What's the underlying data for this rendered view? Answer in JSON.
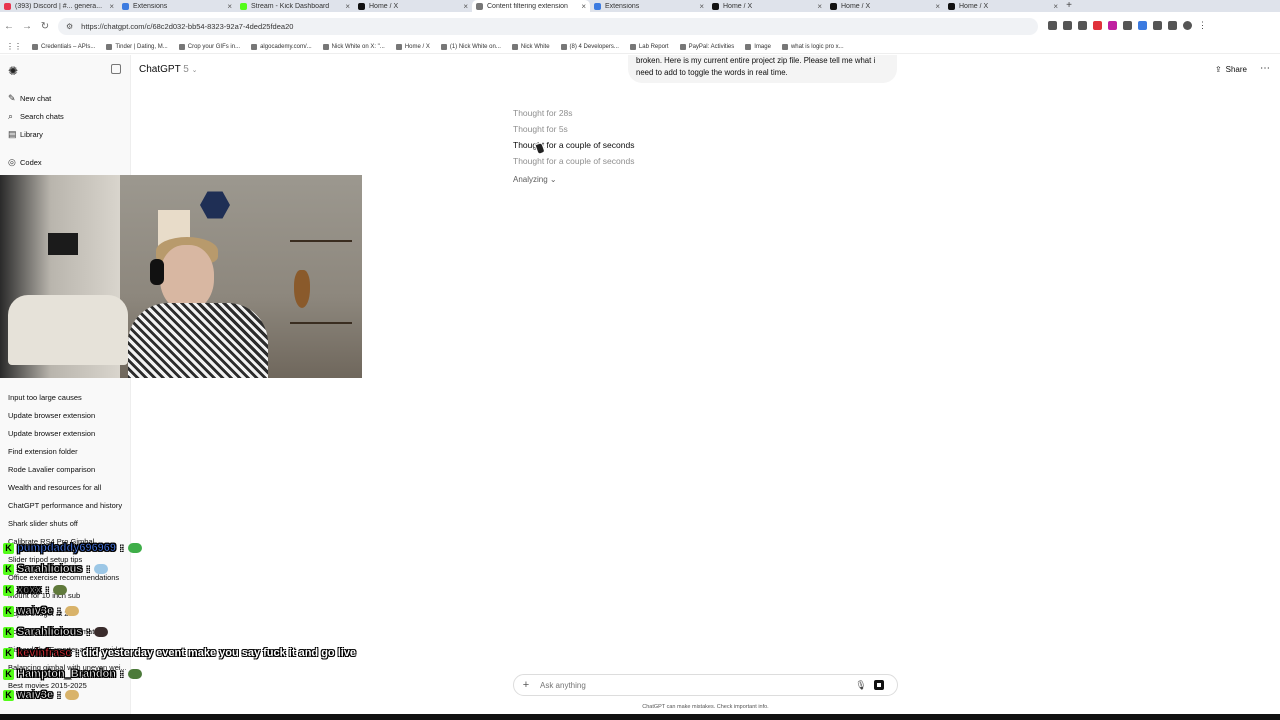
{
  "browser": {
    "tabs": [
      {
        "label": "(393) Discord | #... genera...",
        "color": "#e8344e"
      },
      {
        "label": "Extensions",
        "color": "#3c7be0"
      },
      {
        "label": "Stream - Kick Dashboard",
        "color": "#53fc18"
      },
      {
        "label": "Home / X",
        "color": "#111111"
      },
      {
        "label": "Content filtering extension",
        "color": "#777777"
      },
      {
        "label": "Extensions",
        "color": "#3c7be0"
      },
      {
        "label": "Home / X",
        "color": "#111111"
      },
      {
        "label": "Home / X",
        "color": "#111111"
      },
      {
        "label": "Home / X",
        "color": "#111111"
      }
    ],
    "new_tab": "+",
    "url": "https://chatgpt.com/c/68c2d032-bb54-8323-92a7-4ded25fdea20",
    "bookmarks": [
      "Credentials – APIs...",
      "Tinder | Dating, M...",
      "Crop your GIFs in...",
      "algocademy.com/...",
      "Nick White on X: \"...",
      "Home / X",
      "(1) Nick White on...",
      "Nick White",
      "(8) 4 Developers...",
      "Lab Report",
      "PayPal: Activities",
      "Image",
      "what is logic pro x..."
    ]
  },
  "sidebar": {
    "menu": [
      {
        "icon": "new-chat-icon",
        "glyph": "✎",
        "label": "New chat"
      },
      {
        "icon": "search-icon",
        "glyph": "⌕",
        "label": "Search chats"
      },
      {
        "icon": "library-icon",
        "glyph": "▤",
        "label": "Library"
      },
      {
        "icon": "codex-icon",
        "glyph": "◎",
        "label": "Codex"
      }
    ],
    "chats": [
      "Input too large causes",
      "Update browser extension",
      "Update browser extension",
      "Find extension folder",
      "Rode Lavalier comparison",
      "Wealth and resources for all",
      "ChatGPT performance and history",
      "Shark slider shuts off",
      "Calibrate RS4 Pro Gimbal",
      "Slider tripod setup tips",
      "Office exercise recommendations",
      "Mount for 10 inch sub",
      "Adjust budget at 28+",
      "Adsense earnings estimate",
      "DiscordChatExporter arm64 guide",
      "Balancing gimbal with uneven wei...",
      "Best movies 2015-2025"
    ]
  },
  "header": {
    "model": "ChatGPT",
    "version": "5",
    "share": "Share"
  },
  "conversation": {
    "user_message": "broken. Here is my current entire project zip file. Please tell me what i need to add to toggle the words in real time.",
    "thoughts": [
      "Thought for 28s",
      "Thought for 5s",
      "Thought for a couple of seconds",
      "Thought for a couple of seconds"
    ],
    "status": "Analyzing"
  },
  "composer": {
    "placeholder": "Ask anything",
    "disclaimer": "ChatGPT can make mistakes. Check important info."
  },
  "stream_chat": [
    {
      "user": "pumpdaddy696969",
      "msg": ":",
      "user_color": "#4a7df0",
      "emote": "#3fae49"
    },
    {
      "user": "Sarahlicious",
      "msg": ":",
      "user_color": "#ffffff",
      "emote": "#9cc7e6"
    },
    {
      "user": "xcxx",
      "msg": ":",
      "user_color": "#888888",
      "emote": "#607a3c"
    },
    {
      "user": "waiv3e",
      "msg": ":",
      "user_color": "#ffffff",
      "emote": "#d9b36a"
    },
    {
      "user": "Sarahlicious",
      "msg": ":",
      "user_color": "#ffffff",
      "emote": "#3a2c2c"
    },
    {
      "user": "kevinfrasc",
      "msg": ": did yesterday event make you say fuck it and go live",
      "user_color": "#e0313a",
      "emote": ""
    },
    {
      "user": "Hampton_Brandon",
      "msg": ":",
      "user_color": "#ffffff",
      "emote": "#4c7a3a"
    },
    {
      "user": "waiv3e",
      "msg": ":",
      "user_color": "#ffffff",
      "emote": "#d9b36a"
    }
  ],
  "theme": {
    "kick_green": "#53fc18",
    "sidebar_bg": "#f9f9f9",
    "bubble_bg": "#f4f4f4",
    "muted": "#8f8f8f"
  }
}
